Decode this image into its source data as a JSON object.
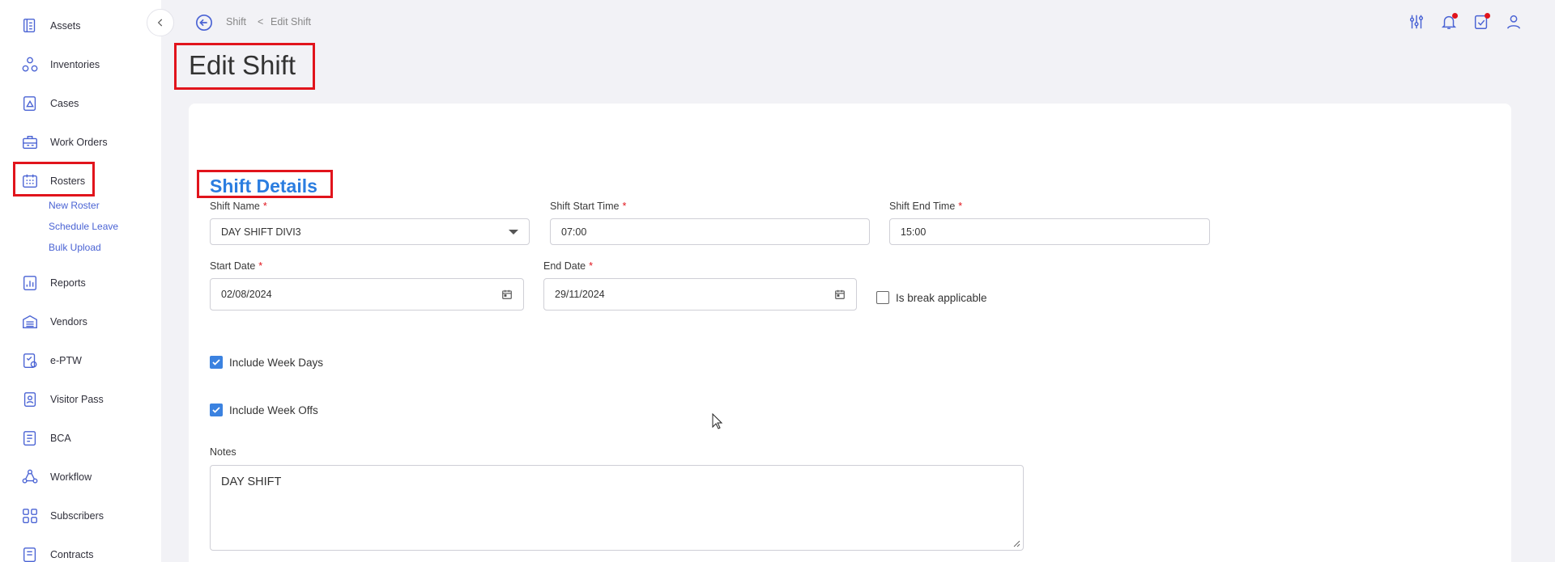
{
  "sidebar": {
    "items": [
      {
        "label": "Assets",
        "icon": "assets-icon"
      },
      {
        "label": "Inventories",
        "icon": "inventories-icon"
      },
      {
        "label": "Cases",
        "icon": "cases-icon"
      },
      {
        "label": "Work Orders",
        "icon": "work-orders-icon"
      },
      {
        "label": "Rosters",
        "icon": "rosters-icon"
      },
      {
        "label": "Reports",
        "icon": "reports-icon"
      },
      {
        "label": "Vendors",
        "icon": "vendors-icon"
      },
      {
        "label": "e-PTW",
        "icon": "eptw-icon"
      },
      {
        "label": "Visitor Pass",
        "icon": "visitor-pass-icon"
      },
      {
        "label": "BCA",
        "icon": "bca-icon"
      },
      {
        "label": "Workflow",
        "icon": "workflow-icon"
      },
      {
        "label": "Subscribers",
        "icon": "subscribers-icon"
      },
      {
        "label": "Contracts",
        "icon": "contracts-icon"
      }
    ],
    "rosters_sub": [
      {
        "label": "New Roster"
      },
      {
        "label": "Schedule Leave"
      },
      {
        "label": "Bulk Upload"
      }
    ]
  },
  "breadcrumb": {
    "parent": "Shift",
    "separator": "<",
    "current": "Edit Shift"
  },
  "page": {
    "title": "Edit Shift"
  },
  "form": {
    "section_title": "Shift Details",
    "required_mark": "*",
    "shift_name": {
      "label": "Shift Name",
      "value": "DAY SHIFT DIVI3"
    },
    "shift_start": {
      "label": "Shift Start Time",
      "value": "07:00"
    },
    "shift_end": {
      "label": "Shift End Time",
      "value": "15:00"
    },
    "start_date": {
      "label": "Start Date",
      "value": "02/08/2024"
    },
    "end_date": {
      "label": "End Date",
      "value": "29/11/2024"
    },
    "break_applicable": {
      "label": "Is break applicable",
      "checked": false
    },
    "include_week_days": {
      "label": "Include Week Days",
      "checked": true
    },
    "include_week_offs": {
      "label": "Include Week Offs",
      "checked": true
    },
    "notes": {
      "label": "Notes",
      "value": "DAY SHIFT"
    }
  },
  "colors": {
    "accent": "#4a63d4",
    "section_title": "#2b7de0",
    "highlight": "#e1141c",
    "checkbox": "#3b82e0"
  }
}
